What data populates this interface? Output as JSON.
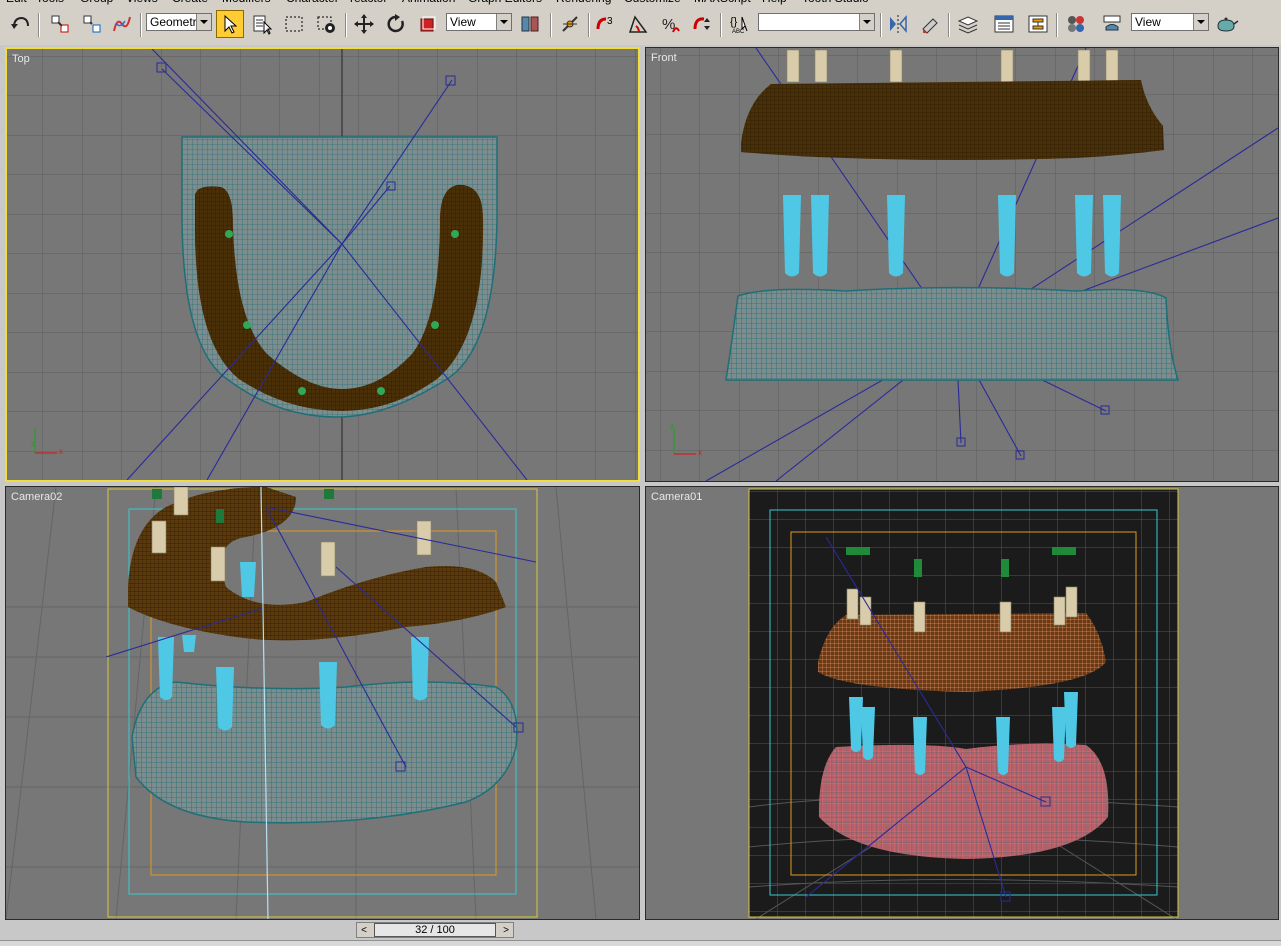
{
  "menu": [
    "Edit",
    "Tools",
    "Group",
    "Views",
    "Create",
    "Modifiers",
    "Character",
    "reactor",
    "Animation",
    "Graph Editors",
    "Rendering",
    "Customize",
    "MAXScript",
    "Help",
    "Tooth Studio"
  ],
  "toolbar": {
    "selection_filter": "Geometry",
    "ref_coord_system": "View",
    "named_selection_set": "",
    "render_view": "View",
    "icons": [
      "undo-icon",
      "select-link-icon",
      "unlink-icon",
      "bind-space-warp-icon",
      "select-object-icon",
      "select-by-name-icon",
      "rect-selection-icon",
      "window-crossing-icon",
      "move-icon",
      "rotate-icon",
      "scale-icon",
      "manipulate-icon",
      "snap-3d-icon",
      "angle-snap-icon",
      "percent-snap-icon",
      "spinner-snap-icon",
      "edit-named-sets-icon",
      "mirror-icon",
      "align-icon",
      "layer-manager-icon",
      "curve-editor-icon",
      "schematic-view-icon",
      "material-editor-icon",
      "render-scene-icon",
      "quick-render-icon"
    ]
  },
  "viewports": {
    "top": {
      "label": "Top"
    },
    "front": {
      "label": "Front"
    },
    "camera02": {
      "label": "Camera02"
    },
    "camera01": {
      "label": "Camera01"
    }
  },
  "axis": {
    "x": "x",
    "z": "z"
  },
  "timeslider": {
    "frame": "32 / 100",
    "prev": "<",
    "next": ">"
  },
  "colors": {
    "viewport_bg": "#777777",
    "active_border": "#f2dd3a",
    "gum_wire": "#1f6f78",
    "teeth_wire": "#4a3008",
    "implant": "#4fc8e6",
    "abutment": "#d8ccaa",
    "helper_lines": "#2a2a9a"
  }
}
